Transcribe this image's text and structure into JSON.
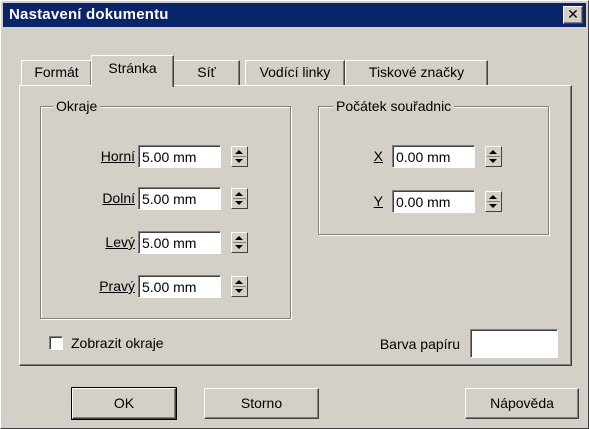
{
  "window": {
    "title": "Nastavení dokumentu",
    "close_glyph": "✕"
  },
  "tabs": [
    {
      "label": "Formát"
    },
    {
      "label": "Stránka",
      "active": true
    },
    {
      "label": "Síť"
    },
    {
      "label": "Vodící linky"
    },
    {
      "label": "Tiskové značky"
    }
  ],
  "margins": {
    "legend": "Okraje",
    "rows": [
      {
        "label": "Horní",
        "value": "5.00 mm"
      },
      {
        "label": "Dolní",
        "value": "5.00 mm"
      },
      {
        "label": "Levý",
        "value": "5.00 mm"
      },
      {
        "label": "Pravý",
        "value": "5.00 mm"
      }
    ]
  },
  "origin": {
    "legend": "Počátek souřadnic",
    "rows": [
      {
        "label": "X",
        "value": "0.00 mm"
      },
      {
        "label": "Y",
        "value": "0.00 mm"
      }
    ]
  },
  "show_margins": {
    "label": "Zobrazit okraje",
    "checked": false
  },
  "paper_color": {
    "label": "Barva papíru",
    "value": "#ffffff"
  },
  "buttons": {
    "ok": "OK",
    "cancel": "Storno",
    "help": "Nápověda"
  }
}
